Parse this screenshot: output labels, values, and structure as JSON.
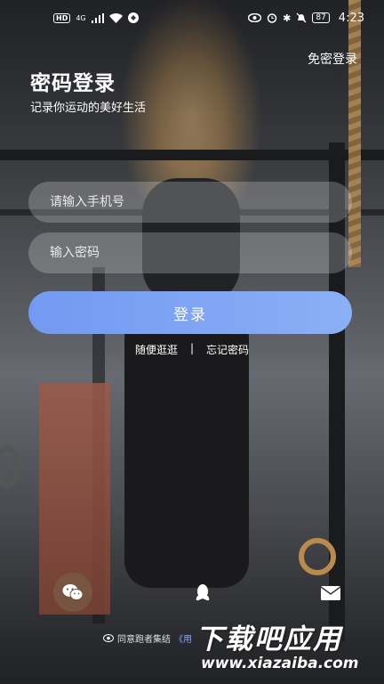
{
  "status_bar": {
    "hd": "HD",
    "signal": "4G",
    "battery": "87",
    "time": "4:23"
  },
  "header": {
    "password_free_login": "免密登录",
    "title": "密码登录",
    "subtitle": "记录你运动的美好生活"
  },
  "form": {
    "phone_placeholder": "请输入手机号",
    "password_placeholder": "输入密码",
    "login_label": "登录"
  },
  "links": {
    "browse": "随便逛逛",
    "separator": "|",
    "forgot": "忘记密码"
  },
  "social": {
    "wechat": "wechat-icon",
    "qq": "qq-icon",
    "mail": "mail-icon"
  },
  "agreement": {
    "text": "同意跑者集结",
    "doc": "《用"
  },
  "watermark": {
    "main": "下载吧应用",
    "sub": "www.xiazaiba.com"
  },
  "colors": {
    "accent": "#7fa2f4",
    "input_bg": "rgba(255,255,255,0.22)"
  }
}
